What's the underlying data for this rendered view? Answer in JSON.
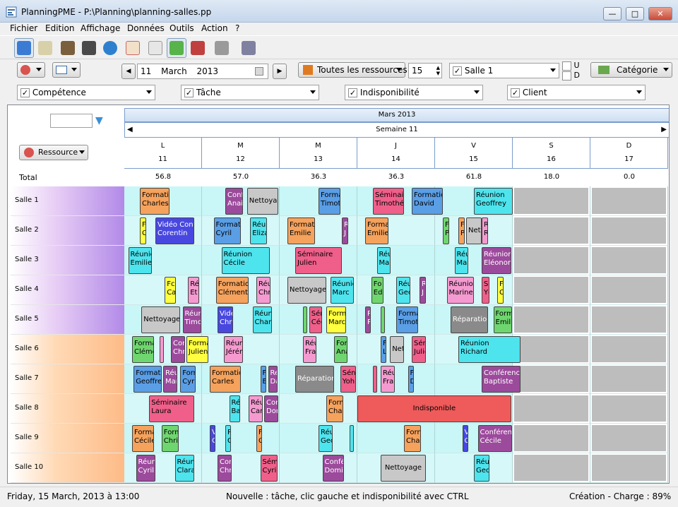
{
  "window": {
    "title": "PlanningPME - P:\\Planning\\planning-salles.pp",
    "minimize": "—",
    "maximize": "□",
    "close": "✕"
  },
  "menu": [
    "Fichier",
    "Edition",
    "Affichage",
    "Données",
    "Outils",
    "Action",
    "?"
  ],
  "toolbar": {
    "icons": [
      "resources-view-icon",
      "task-list-icon",
      "people-icon",
      "book-icon",
      "globe-icon",
      "calendar-icon",
      "grid-icon",
      "add-planning-icon",
      "chart-icon",
      "export-icon",
      "report-icon"
    ]
  },
  "nav": {
    "day": "11",
    "month": "March",
    "year": "2013",
    "prev": "◀",
    "next": "▶",
    "resources_filter": "Toutes les ressources",
    "count": "15",
    "room_filter": "Salle 1",
    "u_label": "U",
    "d_label": "D",
    "category": "Catégorie"
  },
  "filters": [
    {
      "label": "Compétence",
      "checked": "✓"
    },
    {
      "label": "Tâche",
      "checked": "✓"
    },
    {
      "label": "Indisponibilité",
      "checked": "✓"
    },
    {
      "label": "Client",
      "checked": "✓"
    }
  ],
  "grid": {
    "month_label": "Mars 2013",
    "week_label": "Semaine 11",
    "resource_button": "Ressource",
    "total_label": "Total",
    "days": [
      {
        "letter": "L",
        "num": "11",
        "total": "56.8"
      },
      {
        "letter": "M",
        "num": "12",
        "total": "57.0"
      },
      {
        "letter": "M",
        "num": "13",
        "total": "36.3"
      },
      {
        "letter": "J",
        "num": "14",
        "total": "36.3"
      },
      {
        "letter": "V",
        "num": "15",
        "total": "61.8"
      },
      {
        "letter": "S",
        "num": "16",
        "total": "18.0"
      },
      {
        "letter": "D",
        "num": "17",
        "total": "0.0"
      }
    ],
    "rooms": [
      {
        "name": "Salle 1",
        "group": "purple"
      },
      {
        "name": "Salle 2",
        "group": "purple"
      },
      {
        "name": "Salle 3",
        "group": "purple"
      },
      {
        "name": "Salle 4",
        "group": "purple"
      },
      {
        "name": "Salle 5",
        "group": "purple"
      },
      {
        "name": "Salle 6",
        "group": "orange"
      },
      {
        "name": "Salle 7",
        "group": "orange"
      },
      {
        "name": "Salle 8",
        "group": "orange"
      },
      {
        "name": "Salle 9",
        "group": "orange"
      },
      {
        "name": "Salle 10",
        "group": "orange"
      }
    ],
    "colors": {
      "formation": "#f5a25d",
      "reunion": "#4ee4ee",
      "seminaire": "#ef5f8a",
      "conference": "#9c4a9c",
      "nettoyage": "#c8c8c8",
      "reparation": "#8a8a8a",
      "video": "#4848e0",
      "competence": "#6fd66f",
      "formation_blue": "#5a9ee6",
      "yellow": "#ffff40",
      "pink": "#f59ad0",
      "indispo": "#ef5a5a",
      "weekend": "#bdbdbd",
      "slot": "#c9f6f6"
    },
    "blocks": [
      {
        "row": 0,
        "day": 0,
        "o": 0.2,
        "w": 0.38,
        "l1": "Formatic",
        "l2": "Charles",
        "c": "formation"
      },
      {
        "row": 0,
        "day": 1,
        "o": 0.3,
        "w": 0.23,
        "l1": "Conf",
        "l2": "Anai",
        "c": "conference"
      },
      {
        "row": 0,
        "day": 1,
        "o": 0.58,
        "w": 0.4,
        "l1": "",
        "l2": "Nettoyag",
        "c": "nettoyage"
      },
      {
        "row": 0,
        "day": 2,
        "o": 0.5,
        "w": 0.28,
        "l1": "Forma",
        "l2": "Timotl",
        "c": "formation_blue"
      },
      {
        "row": 0,
        "day": 3,
        "o": 0.2,
        "w": 0.4,
        "l1": "Séminair",
        "l2": "Timothé",
        "c": "seminaire"
      },
      {
        "row": 0,
        "day": 3,
        "o": 0.7,
        "w": 0.4,
        "l1": "Formatic",
        "l2": "David",
        "c": "formation_blue"
      },
      {
        "row": 0,
        "day": 4,
        "o": 0.5,
        "w": 0.5,
        "l1": "Réunion",
        "l2": "Geoffrey",
        "c": "reunion"
      },
      {
        "row": 1,
        "day": 0,
        "o": 0.2,
        "w": 0.08,
        "l1": "F",
        "l2": "C",
        "c": "yellow"
      },
      {
        "row": 1,
        "day": 0,
        "o": 0.4,
        "w": 0.5,
        "l1": "Vidéo Conf",
        "l2": "Corentin",
        "c": "video"
      },
      {
        "row": 1,
        "day": 1,
        "o": 0.15,
        "w": 0.35,
        "l1": "Formatic",
        "l2": "Cyril",
        "c": "formation_blue"
      },
      {
        "row": 1,
        "day": 1,
        "o": 0.62,
        "w": 0.22,
        "l1": "Réu",
        "l2": "Eliza",
        "c": "reunion"
      },
      {
        "row": 1,
        "day": 2,
        "o": 0.1,
        "w": 0.35,
        "l1": "Format",
        "l2": "Emilie",
        "c": "formation"
      },
      {
        "row": 1,
        "day": 2,
        "o": 0.8,
        "w": 0.08,
        "l1": "R",
        "l2": "J",
        "c": "conference"
      },
      {
        "row": 1,
        "day": 3,
        "o": 0.1,
        "w": 0.3,
        "l1": "Forma",
        "l2": "Emilie",
        "c": "formation"
      },
      {
        "row": 1,
        "day": 4,
        "o": 0.1,
        "w": 0.08,
        "l1": "F",
        "l2": "P",
        "c": "competence"
      },
      {
        "row": 1,
        "day": 4,
        "o": 0.3,
        "w": 0.08,
        "l1": "F",
        "l2": "P",
        "c": "formation"
      },
      {
        "row": 1,
        "day": 4,
        "o": 0.4,
        "w": 0.2,
        "l1": "",
        "l2": "Net",
        "c": "nettoyage"
      },
      {
        "row": 1,
        "day": 4,
        "o": 0.6,
        "w": 0.08,
        "l1": "R",
        "l2": "R",
        "c": "pink"
      },
      {
        "row": 2,
        "day": 0,
        "o": 0.05,
        "w": 0.3,
        "l1": "Réunic",
        "l2": "Emilie",
        "c": "reunion"
      },
      {
        "row": 2,
        "day": 1,
        "o": 0.25,
        "w": 0.62,
        "l1": "Réunion",
        "l2": "Cécile",
        "c": "reunion"
      },
      {
        "row": 2,
        "day": 2,
        "o": 0.2,
        "w": 0.6,
        "l1": "Séminaire",
        "l2": "Julien",
        "c": "seminaire"
      },
      {
        "row": 2,
        "day": 3,
        "o": 0.25,
        "w": 0.18,
        "l1": "Réu",
        "l2": "Mar",
        "c": "reunion"
      },
      {
        "row": 2,
        "day": 4,
        "o": 0.25,
        "w": 0.18,
        "l1": "Réu",
        "l2": "Mar",
        "c": "reunion"
      },
      {
        "row": 2,
        "day": 4,
        "o": 0.6,
        "w": 0.38,
        "l1": "Réunion",
        "l2": "Eléonore",
        "c": "conference"
      },
      {
        "row": 3,
        "day": 0,
        "o": 0.52,
        "w": 0.14,
        "l1": "Fc",
        "l2": "Ca",
        "c": "yellow"
      },
      {
        "row": 3,
        "day": 0,
        "o": 0.82,
        "w": 0.14,
        "l1": "Ré",
        "l2": "Et",
        "c": "pink"
      },
      {
        "row": 3,
        "day": 1,
        "o": 0.18,
        "w": 0.42,
        "l1": "Formatio",
        "l2": "Clément",
        "c": "formation"
      },
      {
        "row": 3,
        "day": 1,
        "o": 0.7,
        "w": 0.18,
        "l1": "Réu",
        "l2": "Chr",
        "c": "pink"
      },
      {
        "row": 3,
        "day": 2,
        "o": 0.1,
        "w": 0.5,
        "l1": "",
        "l2": "Nettoyage",
        "c": "nettoyage"
      },
      {
        "row": 3,
        "day": 2,
        "o": 0.65,
        "w": 0.3,
        "l1": "Réunic",
        "l2": "Marc",
        "c": "reunion"
      },
      {
        "row": 3,
        "day": 3,
        "o": 0.18,
        "w": 0.16,
        "l1": "Fo",
        "l2": "Ed",
        "c": "competence"
      },
      {
        "row": 3,
        "day": 3,
        "o": 0.5,
        "w": 0.18,
        "l1": "Réu",
        "l2": "Gec",
        "c": "reunion"
      },
      {
        "row": 3,
        "day": 3,
        "o": 0.8,
        "w": 0.08,
        "l1": "R",
        "l2": "J",
        "c": "conference"
      },
      {
        "row": 3,
        "day": 4,
        "o": 0.15,
        "w": 0.35,
        "l1": "Réunion",
        "l2": "Marine",
        "c": "pink"
      },
      {
        "row": 3,
        "day": 4,
        "o": 0.6,
        "w": 0.1,
        "l1": "Se",
        "l2": "Yc",
        "c": "seminaire"
      },
      {
        "row": 3,
        "day": 4,
        "o": 0.8,
        "w": 0.08,
        "l1": "F",
        "l2": "C",
        "c": "yellow"
      },
      {
        "row": 4,
        "day": 0,
        "o": 0.22,
        "w": 0.5,
        "l1": "",
        "l2": "Nettoyage",
        "c": "nettoyage"
      },
      {
        "row": 4,
        "day": 0,
        "o": 0.75,
        "w": 0.24,
        "l1": "Réun",
        "l2": "Timo",
        "c": "conference"
      },
      {
        "row": 4,
        "day": 1,
        "o": 0.2,
        "w": 0.2,
        "l1": "Vidé",
        "l2": "Chris",
        "c": "video"
      },
      {
        "row": 4,
        "day": 1,
        "o": 0.65,
        "w": 0.25,
        "l1": "Réuni",
        "l2": "Charl",
        "c": "reunion"
      },
      {
        "row": 4,
        "day": 2,
        "o": 0.3,
        "w": 0.05,
        "l1": "",
        "l2": "",
        "c": "competence"
      },
      {
        "row": 4,
        "day": 2,
        "o": 0.38,
        "w": 0.17,
        "l1": "Sén",
        "l2": "Céc",
        "c": "seminaire"
      },
      {
        "row": 4,
        "day": 2,
        "o": 0.6,
        "w": 0.25,
        "l1": "Forme",
        "l2": "Marc",
        "c": "yellow"
      },
      {
        "row": 4,
        "day": 3,
        "o": 0.1,
        "w": 0.07,
        "l1": "R",
        "l2": "R",
        "c": "conference"
      },
      {
        "row": 4,
        "day": 3,
        "o": 0.3,
        "w": 0.04,
        "l1": "",
        "l2": "",
        "c": "competence"
      },
      {
        "row": 4,
        "day": 3,
        "o": 0.5,
        "w": 0.28,
        "l1": "Forma",
        "l2": "Timotl",
        "c": "formation_blue"
      },
      {
        "row": 4,
        "day": 4,
        "o": 0.2,
        "w": 0.48,
        "l1": "",
        "l2": "Réparation",
        "c": "reparation"
      },
      {
        "row": 4,
        "day": 4,
        "o": 0.75,
        "w": 0.24,
        "l1": "Form",
        "l2": "Emilie",
        "c": "competence"
      },
      {
        "row": 5,
        "day": 0,
        "o": 0.1,
        "w": 0.28,
        "l1": "Forma",
        "l2": "Cléme",
        "c": "competence"
      },
      {
        "row": 5,
        "day": 0,
        "o": 0.45,
        "w": 0.04,
        "l1": "",
        "l2": "",
        "c": "pink"
      },
      {
        "row": 5,
        "day": 0,
        "o": 0.6,
        "w": 0.18,
        "l1": "Con",
        "l2": "Chr",
        "c": "conference"
      },
      {
        "row": 5,
        "day": 0,
        "o": 0.8,
        "w": 0.28,
        "l1": "Forma",
        "l2": "Julien",
        "c": "yellow"
      },
      {
        "row": 5,
        "day": 1,
        "o": 0.28,
        "w": 0.25,
        "l1": "Réur",
        "l2": "Jérér",
        "c": "pink"
      },
      {
        "row": 5,
        "day": 2,
        "o": 0.3,
        "w": 0.17,
        "l1": "Réu",
        "l2": "Fra",
        "c": "pink"
      },
      {
        "row": 5,
        "day": 2,
        "o": 0.7,
        "w": 0.17,
        "l1": "For",
        "l2": "Ana",
        "c": "competence"
      },
      {
        "row": 5,
        "day": 3,
        "o": 0.3,
        "w": 0.07,
        "l1": "F",
        "l2": "L",
        "c": "formation_blue"
      },
      {
        "row": 5,
        "day": 3,
        "o": 0.42,
        "w": 0.18,
        "l1": "",
        "l2": "Net",
        "c": "nettoyage"
      },
      {
        "row": 5,
        "day": 3,
        "o": 0.7,
        "w": 0.18,
        "l1": "Sén",
        "l2": "Julié",
        "c": "seminaire"
      },
      {
        "row": 5,
        "day": 4,
        "o": 0.3,
        "w": 0.8,
        "l1": "Réunion",
        "l2": "Richard",
        "c": "reunion"
      },
      {
        "row": 6,
        "day": 0,
        "o": 0.12,
        "w": 0.36,
        "l1": "Formatic",
        "l2": "Geoffrey",
        "c": "formation_blue"
      },
      {
        "row": 6,
        "day": 0,
        "o": 0.5,
        "w": 0.18,
        "l1": "Réu",
        "l2": "Mar",
        "c": "conference"
      },
      {
        "row": 6,
        "day": 0,
        "o": 0.72,
        "w": 0.2,
        "l1": "Forn",
        "l2": "Cyri",
        "c": "formation_blue"
      },
      {
        "row": 6,
        "day": 1,
        "o": 0.1,
        "w": 0.4,
        "l1": "Formatic",
        "l2": "Carles",
        "c": "formation"
      },
      {
        "row": 6,
        "day": 1,
        "o": 0.75,
        "w": 0.08,
        "l1": "F",
        "l2": "E",
        "c": "formation_blue"
      },
      {
        "row": 6,
        "day": 1,
        "o": 0.85,
        "w": 0.12,
        "l1": "Ré",
        "l2": "Da",
        "c": "conference"
      },
      {
        "row": 6,
        "day": 2,
        "o": 0.2,
        "w": 0.5,
        "l1": "",
        "l2": "Réparation",
        "c": "reparation"
      },
      {
        "row": 6,
        "day": 2,
        "o": 0.78,
        "w": 0.2,
        "l1": "Sén",
        "l2": "Yoh",
        "c": "seminaire"
      },
      {
        "row": 6,
        "day": 3,
        "o": 0.2,
        "w": 0.04,
        "l1": "",
        "l2": "",
        "c": "seminaire"
      },
      {
        "row": 6,
        "day": 3,
        "o": 0.3,
        "w": 0.18,
        "l1": "Réu",
        "l2": "Fra",
        "c": "pink"
      },
      {
        "row": 6,
        "day": 3,
        "o": 0.65,
        "w": 0.08,
        "l1": "F",
        "l2": "D",
        "c": "formation_blue"
      },
      {
        "row": 6,
        "day": 4,
        "o": 0.6,
        "w": 0.5,
        "l1": "Conférenc",
        "l2": "Baptiste",
        "c": "conference"
      },
      {
        "row": 7,
        "day": 0,
        "o": 0.32,
        "w": 0.58,
        "l1": "Séminaire",
        "l2": "Laura",
        "c": "seminaire"
      },
      {
        "row": 7,
        "day": 1,
        "o": 0.35,
        "w": 0.14,
        "l1": "Ré",
        "l2": "Ba",
        "c": "reunion"
      },
      {
        "row": 7,
        "day": 1,
        "o": 0.6,
        "w": 0.18,
        "l1": "Réu",
        "l2": "Car",
        "c": "pink"
      },
      {
        "row": 7,
        "day": 1,
        "o": 0.8,
        "w": 0.18,
        "l1": "Cor",
        "l2": "Dor",
        "c": "conference"
      },
      {
        "row": 7,
        "day": 2,
        "o": 0.6,
        "w": 0.22,
        "l1": "Forn",
        "l2": "Char",
        "c": "formation"
      },
      {
        "row": 7,
        "day": 3,
        "o": 0.0,
        "w": 1.98,
        "l1": "",
        "l2": "Indisponible",
        "c": "indispo"
      },
      {
        "row": 8,
        "day": 0,
        "o": 0.1,
        "w": 0.28,
        "l1": "Forma",
        "l2": "Cécile",
        "c": "formation"
      },
      {
        "row": 8,
        "day": 0,
        "o": 0.48,
        "w": 0.22,
        "l1": "Form",
        "l2": "Chris",
        "c": "competence"
      },
      {
        "row": 8,
        "day": 1,
        "o": 0.1,
        "w": 0.07,
        "l1": "V",
        "l2": "C",
        "c": "video"
      },
      {
        "row": 8,
        "day": 1,
        "o": 0.3,
        "w": 0.07,
        "l1": "R",
        "l2": "G",
        "c": "reunion"
      },
      {
        "row": 8,
        "day": 1,
        "o": 0.7,
        "w": 0.07,
        "l1": "F",
        "l2": "C",
        "c": "formation"
      },
      {
        "row": 8,
        "day": 2,
        "o": 0.5,
        "w": 0.18,
        "l1": "Réu",
        "l2": "Gec",
        "c": "reunion"
      },
      {
        "row": 8,
        "day": 2,
        "o": 0.9,
        "w": 0.04,
        "l1": "",
        "l2": "",
        "c": "reunion"
      },
      {
        "row": 8,
        "day": 3,
        "o": 0.6,
        "w": 0.22,
        "l1": "Forn",
        "l2": "Char",
        "c": "formation"
      },
      {
        "row": 8,
        "day": 4,
        "o": 0.35,
        "w": 0.08,
        "l1": "V",
        "l2": "C",
        "c": "video"
      },
      {
        "row": 8,
        "day": 4,
        "o": 0.55,
        "w": 0.44,
        "l1": "Conférenc",
        "l2": "Cécile",
        "c": "conference"
      },
      {
        "row": 9,
        "day": 0,
        "o": 0.15,
        "w": 0.25,
        "l1": "Réun",
        "l2": "Cyril",
        "c": "conference"
      },
      {
        "row": 9,
        "day": 0,
        "o": 0.65,
        "w": 0.25,
        "l1": "Réuni",
        "l2": "Clara",
        "c": "reunion"
      },
      {
        "row": 9,
        "day": 1,
        "o": 0.2,
        "w": 0.18,
        "l1": "Con",
        "l2": "Chr",
        "c": "conference"
      },
      {
        "row": 9,
        "day": 1,
        "o": 0.75,
        "w": 0.22,
        "l1": "Sémi",
        "l2": "Cyril",
        "c": "seminaire"
      },
      {
        "row": 9,
        "day": 2,
        "o": 0.55,
        "w": 0.28,
        "l1": "Confé",
        "l2": "Domir",
        "c": "conference"
      },
      {
        "row": 9,
        "day": 3,
        "o": 0.3,
        "w": 0.58,
        "l1": "",
        "l2": "Nettoyage",
        "c": "nettoyage"
      },
      {
        "row": 9,
        "day": 4,
        "o": 0.5,
        "w": 0.2,
        "l1": "Réu",
        "l2": "Gec",
        "c": "reunion"
      }
    ]
  },
  "status": {
    "date": "Friday, 15 March, 2013 à 13:00",
    "hint": "Nouvelle : tâche, clic gauche et indisponibilité avec CTRL",
    "mode": "Création - Charge : 89%"
  }
}
